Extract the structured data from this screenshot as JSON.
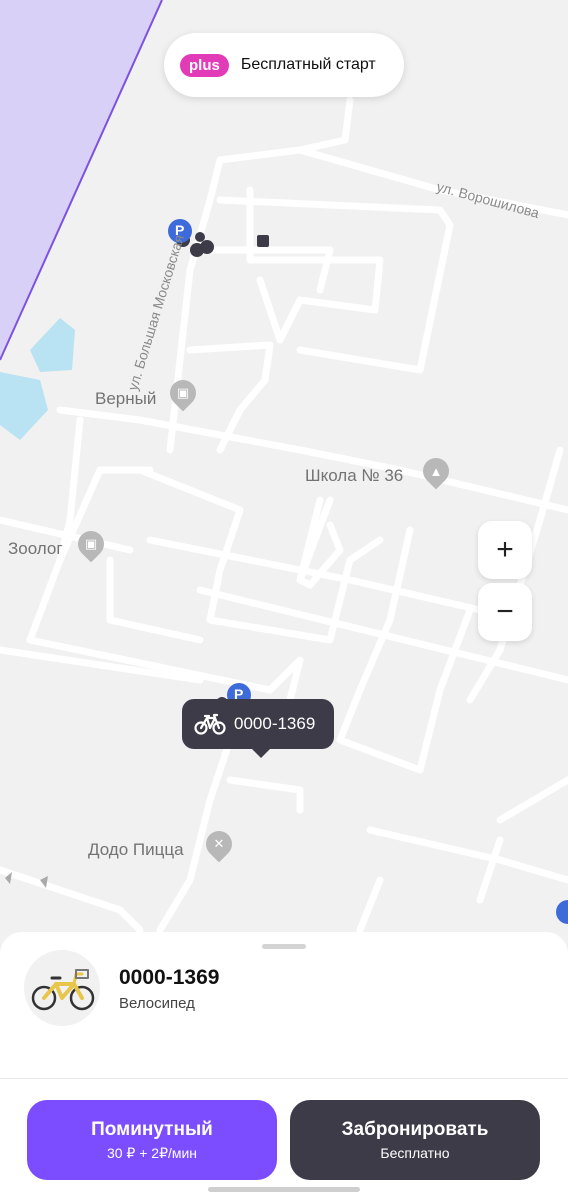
{
  "promo": {
    "badge": "plus",
    "text": "Бесплатный старт"
  },
  "map": {
    "places": [
      {
        "name": "Верный",
        "icon": "shopping-bag-icon"
      },
      {
        "name": "Школа № 36",
        "icon": "graduation-cap-icon"
      },
      {
        "name": "Зоолог",
        "icon": "shopping-bag-icon"
      },
      {
        "name": "Додо Пицца",
        "icon": "fork-knife-icon"
      }
    ],
    "streets": [
      "ул. Большая Московская",
      "ул. Ворошилова"
    ],
    "parking_letter": "P"
  },
  "zoom": {
    "in": "+",
    "out": "−"
  },
  "tooltip": {
    "id": "0000-1369",
    "icon": "bicycle-icon"
  },
  "sheet": {
    "vehicle_id": "0000-1369",
    "vehicle_type": "Велосипед",
    "btn_primary": {
      "label": "Поминутный",
      "sub": "30 ₽ + 2₽/мин",
      "color": "#7c4dff"
    },
    "btn_secondary": {
      "label": "Забронировать",
      "sub": "Бесплатно",
      "color": "#3d3b47"
    }
  }
}
